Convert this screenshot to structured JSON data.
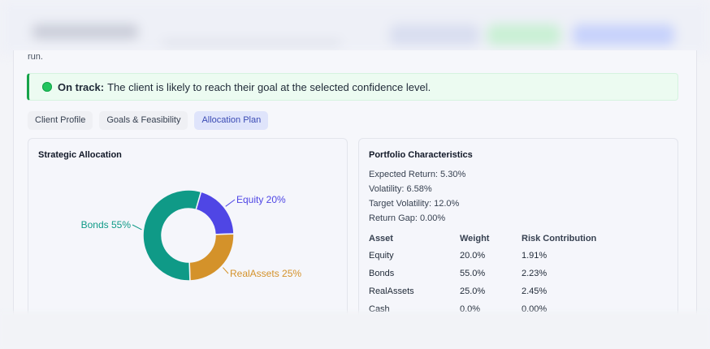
{
  "header_text": {
    "run_tail": "run."
  },
  "status": {
    "label": "On track:",
    "message": "The client is likely to reach their goal at the selected confidence level.",
    "color": "#16a34a"
  },
  "tabs": [
    {
      "label": "Client Profile",
      "active": false
    },
    {
      "label": "Goals & Feasibility",
      "active": false
    },
    {
      "label": "Allocation Plan",
      "active": true
    }
  ],
  "strategic_allocation": {
    "title": "Strategic Allocation",
    "segments": [
      {
        "name": "Equity",
        "value": 20,
        "label": "Equity 20%",
        "color": "#4f46e5"
      },
      {
        "name": "RealAssets",
        "value": 25,
        "label": "RealAssets 25%",
        "color": "#d4922a"
      },
      {
        "name": "Bonds",
        "value": 55,
        "label": "Bonds 55%",
        "color": "#0f9a87"
      }
    ]
  },
  "portfolio_characteristics": {
    "title": "Portfolio Characteristics",
    "metrics": [
      "Expected Return: 5.30%",
      "Volatility: 6.58%",
      "Target Volatility: 12.0%",
      "Return Gap: 0.00%"
    ],
    "table": {
      "headers": [
        "Asset",
        "Weight",
        "Risk Contribution"
      ],
      "rows": [
        [
          "Equity",
          "20.0%",
          "1.91%"
        ],
        [
          "Bonds",
          "55.0%",
          "2.23%"
        ],
        [
          "RealAssets",
          "25.0%",
          "2.45%"
        ],
        [
          "Cash",
          "0.0%",
          "0.00%"
        ]
      ]
    }
  }
}
